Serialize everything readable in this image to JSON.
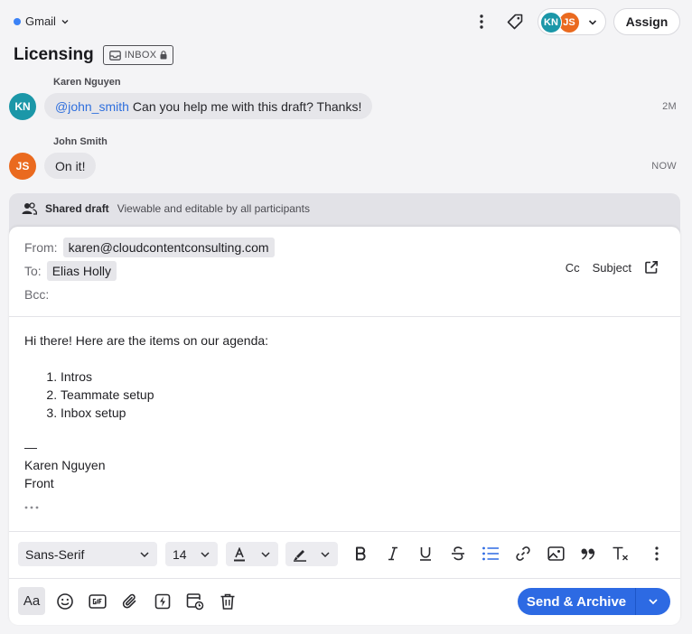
{
  "topbar": {
    "account": "Gmail",
    "account_dot_color": "#3b82f6",
    "avatars": [
      "KN",
      "JS"
    ],
    "assign_label": "Assign"
  },
  "conversation": {
    "title": "Licensing",
    "badge": "INBOX"
  },
  "messages": [
    {
      "sender": "Karen Nguyen",
      "initials": "KN",
      "mention": "@john_smith",
      "text": "Can you help me with this draft? Thanks!",
      "time": "2M"
    },
    {
      "sender": "John Smith",
      "initials": "JS",
      "text": "On it!",
      "time": "NOW"
    }
  ],
  "draft": {
    "header_label": "Shared draft",
    "header_desc": "Viewable and editable by all participants",
    "from_label": "From:",
    "from_value": "karen@cloudcontentconsulting.com",
    "to_label": "To:",
    "to_value": "Elias Holly",
    "bcc_label": "Bcc:",
    "cc_label": "Cc",
    "subject_label": "Subject",
    "intro": "Hi there! Here are the items on our agenda:",
    "items": [
      "Intros",
      "Teammate setup",
      "Inbox setup"
    ],
    "sig_dash": "—",
    "sig_name": "Karen Nguyen",
    "sig_company": "Front"
  },
  "toolbar": {
    "font_family": "Sans-Serif",
    "font_size": "14",
    "aa_label": "Aa",
    "send_label": "Send & Archive"
  },
  "colors": {
    "kn_avatar": "#1b97a8",
    "js_avatar": "#ea6a1f",
    "accent": "#2d6ae3",
    "mention": "#2f6fdd"
  }
}
